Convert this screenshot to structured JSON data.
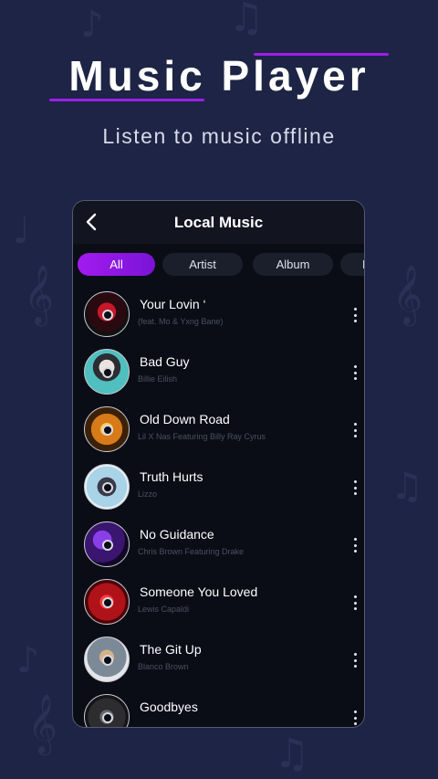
{
  "hero": {
    "title": "Music Player",
    "subtitle": "Listen to music offline"
  },
  "screen": {
    "title": "Local Music",
    "tabs": [
      "All",
      "Artist",
      "Album",
      "F"
    ]
  },
  "songs": [
    {
      "title": "Your Lovin ‘",
      "artist": "(feat. Mo & Yxng Bane)",
      "cover_icon": "album-cover-red-heart"
    },
    {
      "title": "Bad Guy",
      "artist": "Billie Eilish",
      "cover_icon": "album-cover-teal"
    },
    {
      "title": "Old Down Road",
      "artist": "Lil X Nas Featuring Billy Ray Cyrus",
      "cover_icon": "album-cover-orange"
    },
    {
      "title": "Truth Hurts",
      "artist": "Lizzo",
      "cover_icon": "album-cover-light-blue"
    },
    {
      "title": "No Guidance",
      "artist": "Chris Brown Featuring Drake",
      "cover_icon": "album-cover-purple"
    },
    {
      "title": "Someone You Loved",
      "artist": "Lewis Capaldi",
      "cover_icon": "album-cover-red"
    },
    {
      "title": "The Git Up",
      "artist": "Blanco Brown",
      "cover_icon": "album-cover-grey"
    },
    {
      "title": "Goodbyes",
      "artist": "",
      "cover_icon": "album-cover-dark"
    }
  ],
  "colors": {
    "background": "#1e2445",
    "accent": "#9b1fe8",
    "card": "#0b0d16"
  }
}
